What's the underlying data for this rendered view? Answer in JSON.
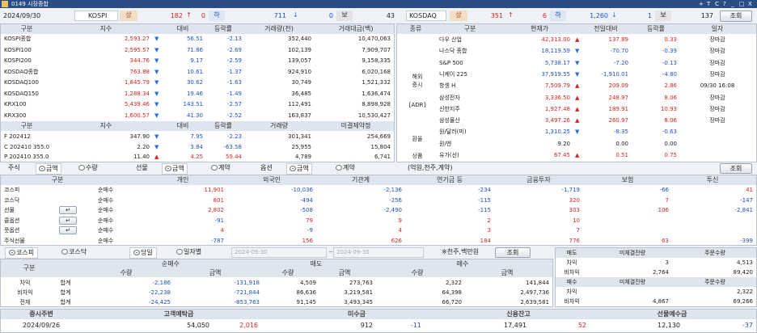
{
  "window": {
    "id": "0149",
    "title": "시장종합",
    "controls": [
      "+",
      "T",
      "C",
      "?",
      "_",
      "□",
      "X"
    ]
  },
  "top": {
    "date": "2024/09/30",
    "kospi": {
      "name": "KOSPI",
      "s_label": "상",
      "s1": "182",
      "s2": "0",
      "h_label": "하",
      "h1": "711",
      "h2": "0",
      "b_label": "보",
      "b": "43"
    },
    "kosdaq": {
      "name": "KOSDAQ",
      "s_label": "상",
      "s1": "351",
      "s2": "6",
      "h_label": "하",
      "h1": "1,260",
      "h2": "1",
      "b_label": "보",
      "b": "137"
    },
    "query_label": "조회"
  },
  "index_table": {
    "headers": [
      "구분",
      "지수",
      "대비",
      "등락률",
      "거래량(천)",
      "거래대금(백)"
    ],
    "rows": [
      {
        "name": "KOSPI종합",
        "v": "2,593.27",
        "dir": "dn",
        "chg": "56.51",
        "rate": "-2.13",
        "vol": "352,440",
        "amt": "10,470,063"
      },
      {
        "name": "KOSPI100",
        "v": "2,595.57",
        "dir": "dn",
        "chg": "71.86",
        "rate": "-2.69",
        "vol": "102,139",
        "amt": "7,909,707"
      },
      {
        "name": "KOSPI200",
        "v": "344.76",
        "dir": "dn",
        "chg": "9.17",
        "rate": "-2.59",
        "vol": "139,057",
        "amt": "9,158,335"
      },
      {
        "name": "KOSDAQ종합",
        "v": "763.88",
        "dir": "dn",
        "chg": "10.61",
        "rate": "-1.37",
        "vol": "924,910",
        "amt": "6,020,168"
      },
      {
        "name": "KOSDAQ100",
        "v": "1,845.79",
        "dir": "dn",
        "chg": "30.62",
        "rate": "-1.63",
        "vol": "30,749",
        "amt": "1,521,332"
      },
      {
        "name": "KOSDAQ150",
        "v": "1,288.34",
        "dir": "dn",
        "chg": "19.46",
        "rate": "-1.49",
        "vol": "36,485",
        "amt": "1,636,474"
      },
      {
        "name": "KRX100",
        "v": "5,439.46",
        "dir": "dn",
        "chg": "143.51",
        "rate": "-2.57",
        "vol": "112,491",
        "amt": "8,898,928"
      },
      {
        "name": "KRX300",
        "v": "1,600.57",
        "dir": "dn",
        "chg": "41.30",
        "rate": "-2.52",
        "vol": "163,837",
        "amt": "10,530,427"
      }
    ]
  },
  "futures_table": {
    "headers": [
      "구분",
      "지수",
      "대비",
      "등락률",
      "거래량",
      "미결제약정"
    ],
    "rows": [
      {
        "name": "F 202412",
        "v": "347.90",
        "dir": "dn",
        "chg": "7.95",
        "rate": "-2.23",
        "vol": "301,341",
        "oi": "254,669"
      },
      {
        "name": "C 202410 355.0",
        "v": "2.20",
        "dir": "dn",
        "chg": "3.84",
        "rate": "-63.58",
        "vol": "25,955",
        "oi": "15,804"
      },
      {
        "name": "P 202410 355.0",
        "v": "11.40",
        "dir": "up",
        "chg": "4.25",
        "rate": "59.44",
        "vol": "4,789",
        "oi": "6,741"
      }
    ]
  },
  "global_table": {
    "headers": [
      "종류",
      "구분",
      "현재가",
      "전일대비",
      "등락률",
      "일자"
    ],
    "groups": {
      "overseas": "해외\n증시",
      "adr": "[ADR]",
      "fx": "환율",
      "commodity": "상품"
    },
    "rows": [
      {
        "name": "다우 산업",
        "v": "42,313.00",
        "dir": "up",
        "chg": "137.89",
        "rate": "0.33",
        "date": "장마감",
        "color": "red"
      },
      {
        "name": "나스닥 종합",
        "v": "18,119.59",
        "dir": "dn",
        "chg": "-70.70",
        "rate": "-0.39",
        "date": "장마감",
        "color": "blue"
      },
      {
        "name": "S&P 500",
        "v": "5,738.17",
        "dir": "dn",
        "chg": "-7.20",
        "rate": "-0.13",
        "date": "장마감",
        "color": "blue"
      },
      {
        "name": "니케이 225",
        "v": "37,919.55",
        "dir": "dn",
        "chg": "-1,910.01",
        "rate": "-4.80",
        "date": "장마감",
        "color": "blue"
      },
      {
        "name": "항셍 H",
        "v": "7,509.79",
        "dir": "up",
        "chg": "209.09",
        "rate": "2.86",
        "date": "09/30 16:08",
        "color": "red"
      },
      {
        "name": "삼성전자",
        "v": "3,336.50",
        "dir": "up",
        "chg": "248.97",
        "rate": "8.06",
        "date": "장마감",
        "color": "red"
      },
      {
        "name": "신한지주",
        "v": "1,927.48",
        "dir": "up",
        "chg": "189.91",
        "rate": "10.93",
        "date": "장마감",
        "color": "red"
      },
      {
        "name": "삼성물산",
        "v": "3,497.26",
        "dir": "up",
        "chg": "260.97",
        "rate": "8.06",
        "date": "장마감",
        "color": "red"
      },
      {
        "name": "원/달러(미)",
        "v": "1,310.25",
        "dir": "dn",
        "chg": "-8.35",
        "rate": "-0.63",
        "date": "",
        "color": "blue"
      },
      {
        "name": "원/엔",
        "v": "9.20",
        "dir": "",
        "chg": "0.00",
        "rate": "0.00",
        "date": "",
        "color": "black"
      },
      {
        "name": "유가(선)",
        "v": "67.45",
        "dir": "up",
        "chg": "0.51",
        "rate": "0.75",
        "date": "",
        "color": "red"
      }
    ]
  },
  "options_bar": {
    "stock_label": "주식",
    "futures_label": "선물",
    "option_label": "옵션",
    "amount": "금액",
    "qty": "수량",
    "contract": "계약",
    "unit_note": "(억원,천주,계약)",
    "query_label": "조회"
  },
  "investor_table": {
    "headers": [
      "구분",
      "",
      "개인",
      "외국인",
      "기관계",
      "연기금 등",
      "금융투자",
      "보험",
      "투신"
    ],
    "rows": [
      {
        "name": "코스피",
        "kind": "순매수",
        "vals": [
          "11,901",
          "-10,036",
          "-2,136",
          "-234",
          "-1,719",
          "-66",
          "41"
        ]
      },
      {
        "name": "코스닥",
        "kind": "순매수",
        "vals": [
          "801",
          "-494",
          "-256",
          "-115",
          "320",
          "7",
          "-147"
        ]
      },
      {
        "name": "선물",
        "kind": "순매수",
        "vals": [
          "2,802",
          "-508",
          "-2,490",
          "-115",
          "303",
          "106",
          "-2,841"
        ]
      },
      {
        "name": "콜옵션",
        "kind": "순매수",
        "vals": [
          "-91",
          "79",
          "9",
          "2",
          "10",
          "",
          ""
        ]
      },
      {
        "name": "풋옵션",
        "kind": "순매수",
        "vals": [
          "4",
          "-9",
          "4",
          "3",
          "7",
          "",
          ""
        ]
      },
      {
        "name": "주식선물",
        "kind": "순매수",
        "vals": [
          "-787",
          "156",
          "626",
          "184",
          "776",
          "63",
          "-399"
        ]
      }
    ]
  },
  "program_bar": {
    "kospi": "코스피",
    "kosdaq": "코스닥",
    "daily": "당일",
    "by_date": "일자별",
    "date_from": "2024-09-30",
    "date_to": "2024-09-30",
    "unit": "※천주,백만원",
    "query_label": "조회"
  },
  "program_table": {
    "headers": [
      "구분",
      "",
      "순매수",
      "",
      "매도",
      "",
      "매수",
      ""
    ],
    "sub": [
      "수량",
      "금액",
      "수량",
      "금액",
      "수량",
      "금액"
    ],
    "rows": [
      {
        "name": "차익",
        "kind": "합계",
        "vals": [
          "-2,186",
          "-131,918",
          "4,509",
          "273,763",
          "2,322",
          "141,844"
        ]
      },
      {
        "name": "비차익",
        "kind": "합계",
        "vals": [
          "-22,238",
          "-721,844",
          "86,636",
          "3,219,581",
          "64,398",
          "2,497,736"
        ]
      },
      {
        "name": "전체",
        "kind": "합계",
        "vals": [
          "-24,425",
          "-853,763",
          "91,145",
          "3,493,345",
          "66,720",
          "2,639,581"
        ]
      }
    ]
  },
  "balance_table": {
    "r1": {
      "label": "매도",
      "c1": "미체결잔량",
      "c2": "주문수량"
    },
    "r2": {
      "label": "차익",
      "c1": "3",
      "c2": "4,513"
    },
    "r3": {
      "label": "비차익",
      "c1": "2,764",
      "c2": "89,420"
    },
    "r4": {
      "label": "매수",
      "c1": "미체결잔량",
      "c2": "주문수량"
    },
    "r5": {
      "label": "차익",
      "c1": "",
      "c2": "2,322"
    },
    "r6": {
      "label": "비차익",
      "c1": "4,867",
      "c2": "69,266"
    }
  },
  "deposit_table": {
    "headers": [
      "증시주변",
      "고객예탁금",
      "미수금",
      "신용잔고",
      "선물예수금"
    ],
    "date": "2024/09/26",
    "vals": [
      "54,050",
      "2,016",
      "912",
      "-11",
      "17,491",
      "52",
      "12,130",
      "-37"
    ]
  }
}
